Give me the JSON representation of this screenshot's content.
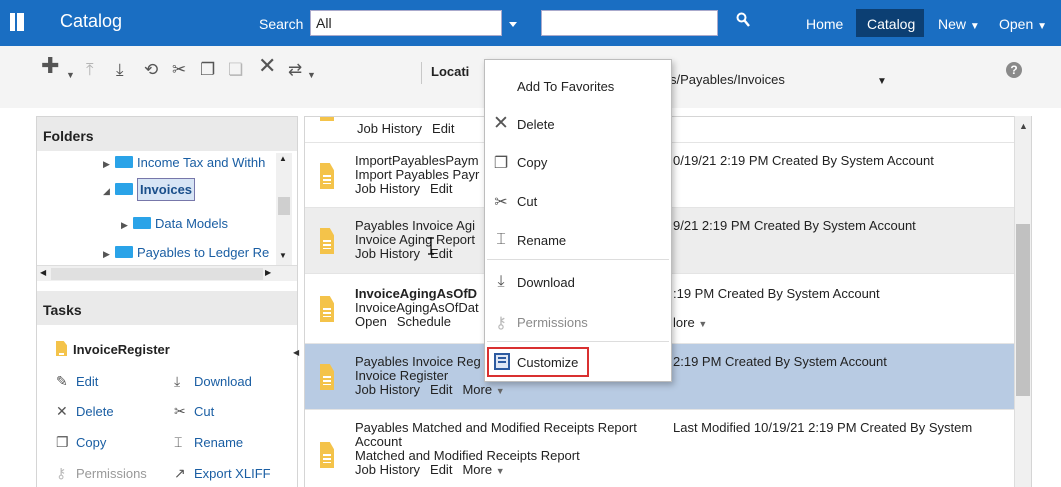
{
  "header": {
    "title": "Catalog",
    "search_label": "Search",
    "search_scope": "All",
    "nav": [
      "Home",
      "Catalog",
      "New",
      "Open"
    ]
  },
  "toolbar": {
    "location_label": "Locati",
    "location_value": "s/Payables/Invoices",
    "help": "?"
  },
  "folders": {
    "title": "Folders",
    "items": [
      "Income Tax and Withh",
      "Invoices",
      "Data Models",
      "Payables to Ledger Re"
    ]
  },
  "tasks": {
    "title": "Tasks",
    "selected_item": "InvoiceRegister",
    "left": [
      "Edit",
      "Delete",
      "Copy",
      "Permissions"
    ],
    "right": [
      "Download",
      "Cut",
      "Rename",
      "Export XLIFF"
    ]
  },
  "list": {
    "rows": [
      {
        "title": "",
        "subtitle": "",
        "links": [
          "Job History",
          "Edit"
        ],
        "meta": ""
      },
      {
        "title": "ImportPayablesPaym",
        "subtitle": "Import Payables Payr",
        "links": [
          "Job History",
          "Edit"
        ],
        "meta": "0/19/21 2:19 PM   Created By System Account"
      },
      {
        "title": "Payables Invoice Agi",
        "subtitle": "Invoice Aging Report",
        "links": [
          "Job History",
          "Edit"
        ],
        "meta": "9/21 2:19 PM   Created By System Account"
      },
      {
        "title": "InvoiceAgingAsOfD",
        "subtitle": "InvoiceAgingAsOfDat",
        "links": [
          "Open",
          "Schedule"
        ],
        "more": "lore",
        "meta": ":19 PM   Created By System Account"
      },
      {
        "title": "Payables Invoice Reg",
        "subtitle": "Invoice Register",
        "links": [
          "Job History",
          "Edit"
        ],
        "more": "More",
        "meta": "2:19 PM   Created By System Account"
      },
      {
        "title": "Payables Matched and Modified Receipts Report",
        "title2": "Account",
        "subtitle": "Matched and Modified Receipts Report",
        "links": [
          "Job History",
          "Edit"
        ],
        "more": "More",
        "meta": "Last Modified 10/19/21 2:19 PM   Created By System"
      }
    ]
  },
  "context_menu": {
    "items": [
      "Add To Favorites",
      "Delete",
      "Copy",
      "Cut",
      "Rename",
      "Download",
      "Permissions",
      "Customize"
    ]
  },
  "colors": {
    "header_bg": "#1a6ec2",
    "selected_row": "#b8cbe3",
    "highlight": "#d93030"
  }
}
